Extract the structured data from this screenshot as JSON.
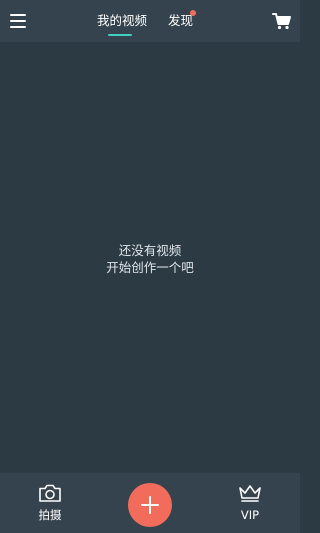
{
  "header": {
    "tabs": [
      {
        "label": "我的视频",
        "active": true
      },
      {
        "label": "发现",
        "has_notification_dot": true
      }
    ],
    "icons": {
      "menu": "hamburger-menu-icon",
      "cart": "shopping-cart-icon"
    }
  },
  "empty_state": {
    "line1": "还没有视频",
    "line2": "开始创作一个吧"
  },
  "bottom_bar": {
    "camera_label": "拍摄",
    "vip_label": "VIP",
    "add_icon": "plus-icon"
  },
  "colors": {
    "background": "#2c3a44",
    "bar": "#34434d",
    "accent_underline": "#3fd1c0",
    "add_button": "#f26c5b",
    "notification_dot": "#f26c5b"
  }
}
